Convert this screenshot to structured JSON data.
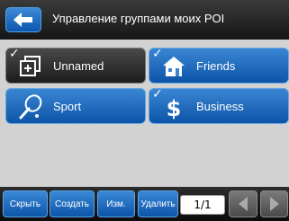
{
  "header": {
    "title": "Управление группами моих POI"
  },
  "groups": [
    {
      "label": "Unnamed",
      "checked": true,
      "icon": "unnamed-group-icon",
      "style": "dark"
    },
    {
      "label": "Friends",
      "checked": true,
      "icon": "house-icon",
      "style": "blue"
    },
    {
      "label": "Sport",
      "checked": false,
      "icon": "tennis-racket-icon",
      "style": "blue"
    },
    {
      "label": "Business",
      "checked": true,
      "icon": "dollar-icon",
      "style": "blue"
    }
  ],
  "toolbar": {
    "hide_label": "Скрыть",
    "create_label": "Создать",
    "edit_label": "Изм.",
    "delete_label": "Удалить",
    "page_indicator": "1/1"
  },
  "check_glyph": "✓"
}
